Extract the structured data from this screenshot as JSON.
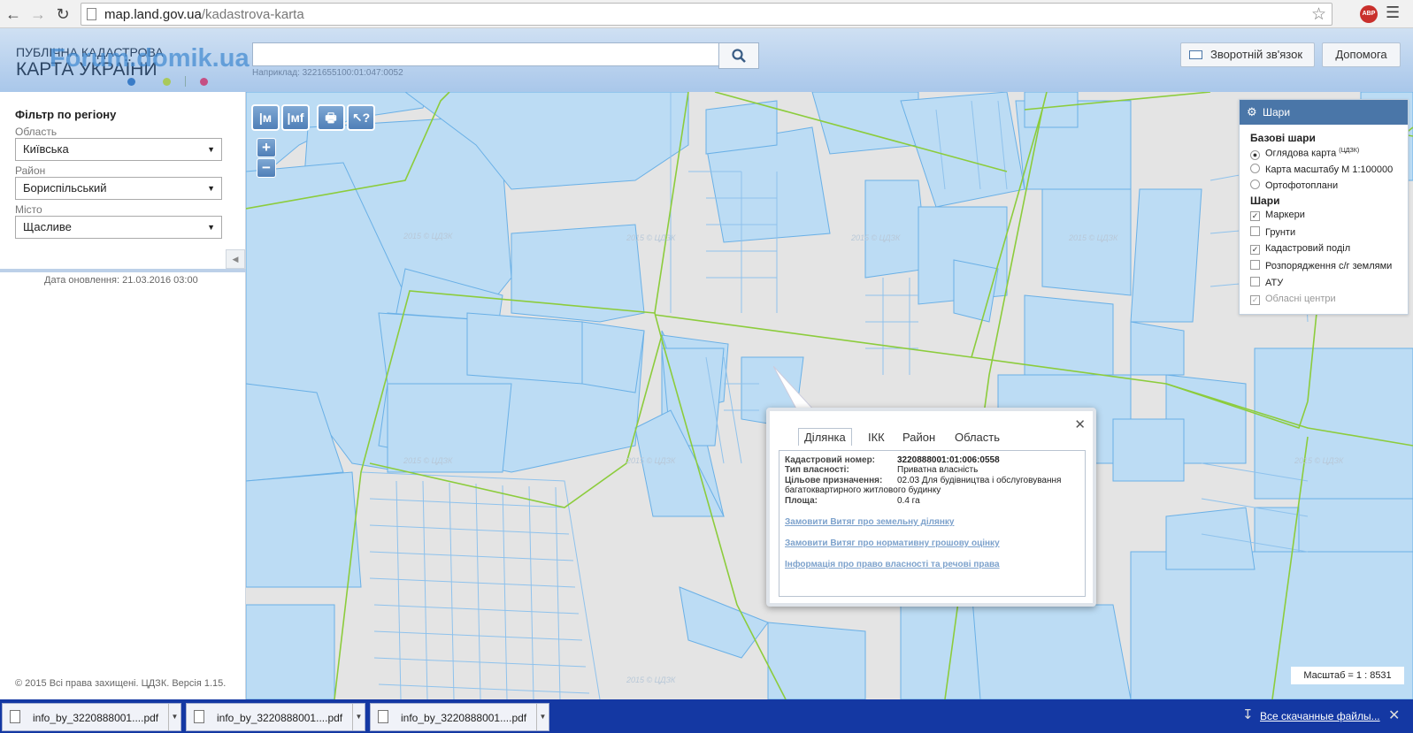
{
  "browser": {
    "url_host": "map.land.gov.ua",
    "url_path": "/kadastrova-karta",
    "abp_badge": "ABP"
  },
  "header": {
    "logo_line1": "ПУБЛІЧНА КАДАСТРОВА",
    "logo_line2": "КАРТА УКРАЇНИ",
    "watermark": "Forum.domik.ua",
    "search_placeholder": "",
    "search_hint": "Наприклад: 3221655100:01:047:0052",
    "feedback_button": "Зворотній зв'язок",
    "help_button": "Допомога"
  },
  "sidebar": {
    "title": "Фільтр по регіону",
    "oblast_label": "Область",
    "oblast_value": "Київська",
    "rayon_label": "Район",
    "rayon_value": "Бориспільський",
    "city_label": "Місто",
    "city_value": "Щасливе",
    "updated": "Дата оновлення: 21.03.2016 03:00",
    "copyright": "© 2015 Всі права захищені. ЦДЗК. Версія 1.15."
  },
  "map": {
    "tile_watermark": "2015 © ЦДЗК",
    "zoom_in": "+",
    "zoom_out": "−",
    "scale": "Масштаб = 1 : 8531",
    "colors": {
      "background": "#e4e4e4",
      "parcel_fill": "#bcdcf4",
      "parcel_stroke": "#6ab0e6",
      "boundary": "#8ccc3c"
    }
  },
  "toolbar": {
    "tool_measure_m": "|м",
    "tool_measure_mf": "|мf",
    "tool_print": "🖶",
    "tool_identify": "↖?"
  },
  "layers": {
    "title": "Шари",
    "base_title": "Базові шари",
    "base": [
      {
        "label": "Оглядова карта",
        "sup": "(ЦДЗК)",
        "selected": true
      },
      {
        "label": "Карта масштабу М 1:100000",
        "selected": false
      },
      {
        "label": "Ортофотоплани",
        "selected": false
      }
    ],
    "layers_title": "Шари",
    "items": [
      {
        "label": "Маркери",
        "checked": true,
        "disabled": false
      },
      {
        "label": "Грунти",
        "checked": false,
        "disabled": false
      },
      {
        "label": "Кадастровий поділ",
        "checked": true,
        "disabled": false
      },
      {
        "label": "Розпорядження с/г землями",
        "checked": false,
        "disabled": false
      },
      {
        "label": "АТУ",
        "checked": false,
        "disabled": false
      },
      {
        "label": "Обласні центри",
        "checked": true,
        "disabled": true
      }
    ]
  },
  "popup": {
    "tabs": [
      "Ділянка",
      "ІКК",
      "Район",
      "Область"
    ],
    "active_tab": "Ділянка",
    "cad_label": "Кадастровий номер:",
    "cad_value": "3220888001:01:006:0558",
    "owner_label": "Тип власності:",
    "owner_value": "Приватна власність",
    "purpose_label": "Цільове призначення:",
    "purpose_value_1": "02.03 Для будівництва і обслуговування",
    "purpose_value_2": "багатоквартирного житлового будинку",
    "area_label": "Площа:",
    "area_value": "0.4 га",
    "link1": "Замовити Витяг про земельну ділянку",
    "link2": "Замовити Витяг про нормативну грошову оцінку",
    "link3": "Інформація про право власності та речові права"
  },
  "downloads": {
    "items": [
      "info_by_3220888001....pdf",
      "info_by_3220888001....pdf",
      "info_by_3220888001....pdf"
    ],
    "show_all": "Все скачанные файлы..."
  }
}
